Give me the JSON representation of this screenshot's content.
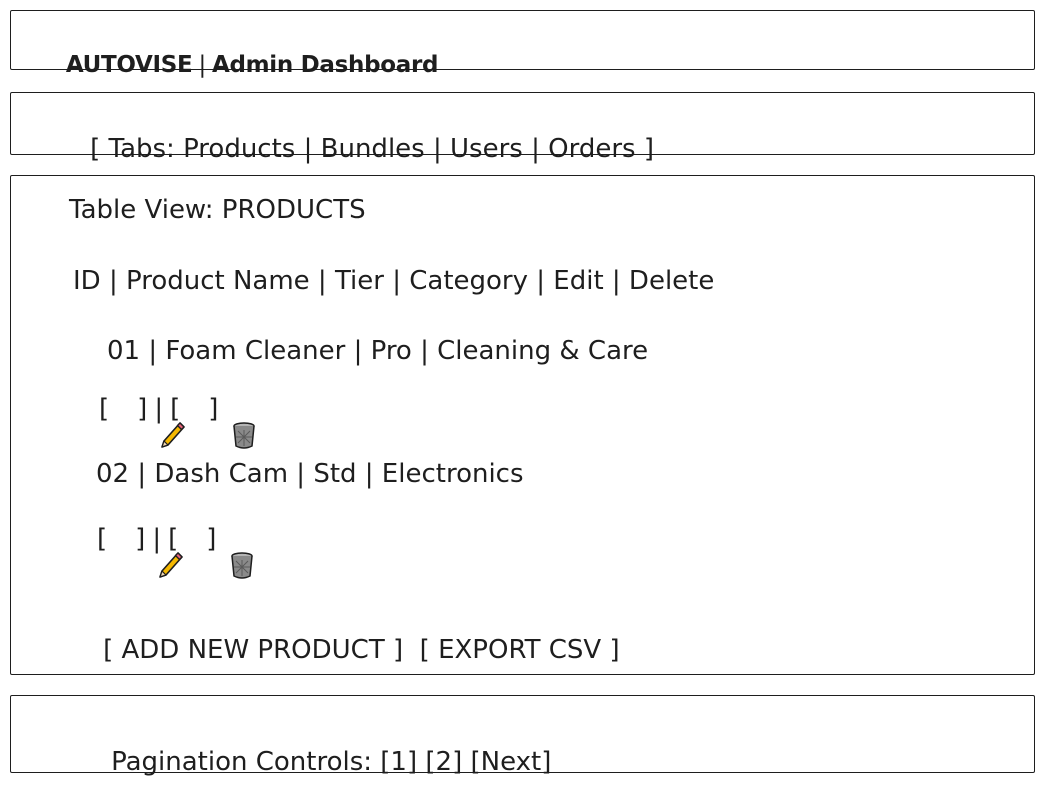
{
  "header": {
    "brand": "AUTOVISE",
    "separator": "|",
    "title": "Admin Dashboard"
  },
  "tabs": {
    "open_bracket": "[",
    "prefix": "Tabs:",
    "items": [
      "Products",
      "Bundles",
      "Users",
      "Orders"
    ],
    "separator": "|",
    "close_bracket": "]"
  },
  "table": {
    "view_label": "Table View: PRODUCTS",
    "columns_line": "ID | Product Name | Tier | Category | Edit | Delete",
    "rows": [
      {
        "line": "01 | Foam Cleaner | Pro | Cleaning & Care",
        "edit_icon": "pencil-icon",
        "delete_icon": "trash-icon"
      },
      {
        "line": "02 | Dash Cam | Std | Electronics",
        "edit_icon": "pencil-icon",
        "delete_icon": "trash-icon"
      }
    ],
    "action_open": "[",
    "action_close": "]",
    "action_separator": "|"
  },
  "actions": {
    "add_label": "[ ADD NEW PRODUCT ]",
    "export_label": "[ EXPORT CSV ]"
  },
  "pagination": {
    "label": "Pagination Controls:",
    "pages": [
      "[1]",
      "[2]"
    ],
    "next": "[Next]"
  },
  "colors": {
    "stroke": "#1e1e1e",
    "pencil_body": "#f5b800",
    "pencil_tip": "#e8637a",
    "trash": "#8a8a8a"
  }
}
